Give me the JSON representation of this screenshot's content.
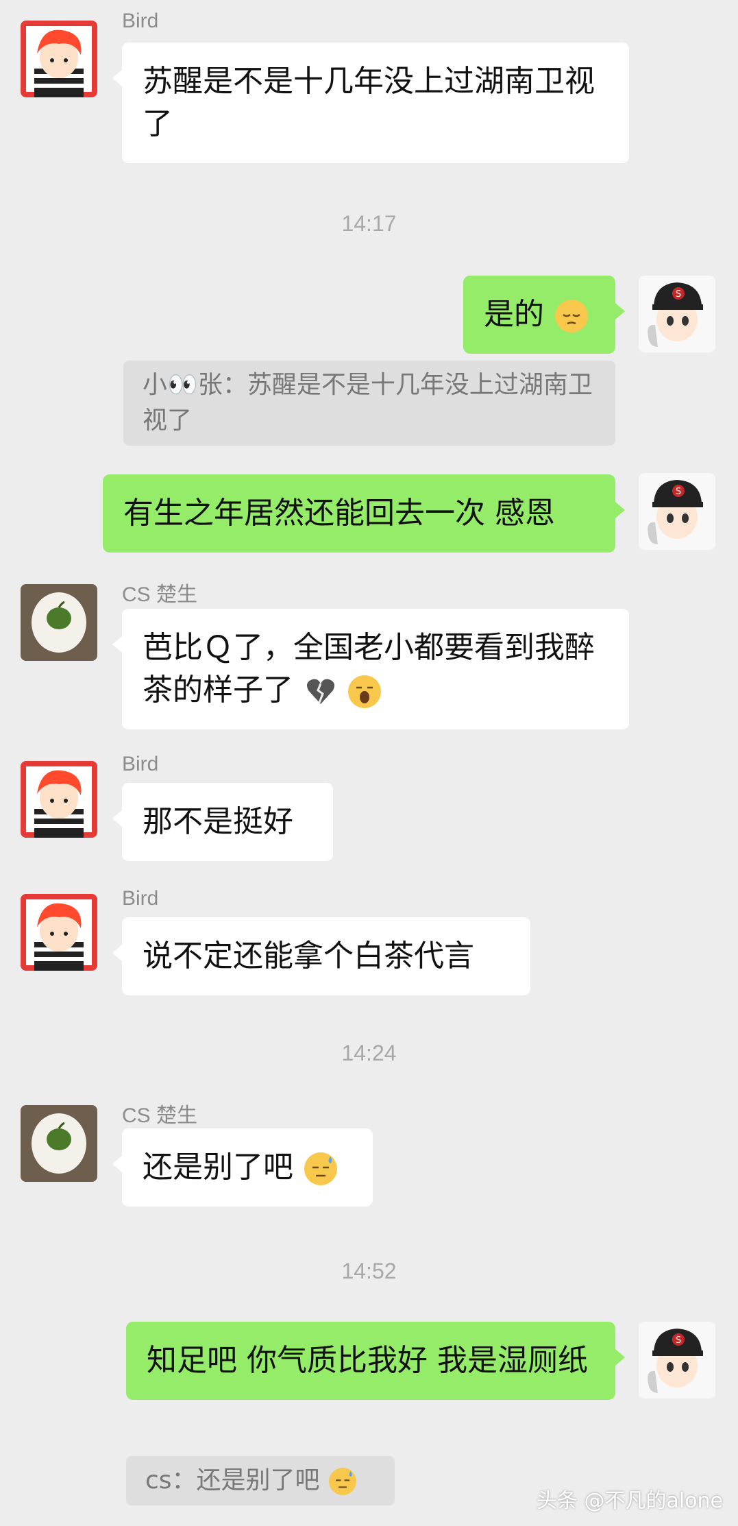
{
  "messages": [
    {
      "sender": "Bird",
      "text": "苏醒是不是十几年没上过湖南卫视了"
    },
    {
      "time": "14:17"
    },
    {
      "text": "是的",
      "emoji": "pensive-emoji"
    },
    {
      "quote": "小👀张：苏醒是不是十几年没上过湖南卫视了"
    },
    {
      "text": "有生之年居然还能回去一次 感恩"
    },
    {
      "sender": "CS 楚生",
      "text": "芭比Ｑ了，全国老小都要看到我醉茶的样子了",
      "emoji": [
        "broken-heart-emoji",
        "yawn-emoji"
      ]
    },
    {
      "sender": "Bird",
      "text": "那不是挺好"
    },
    {
      "sender": "Bird",
      "text": "说不定还能拿个白茶代言"
    },
    {
      "time": "14:24"
    },
    {
      "sender": "CS 楚生",
      "text": "还是别了吧",
      "emoji": "sweat-emoji"
    },
    {
      "time": "14:52"
    },
    {
      "text": "知足吧 你气质比我好 我是湿厕纸"
    },
    {
      "quote": "cs：还是别了吧",
      "emoji": "sweat-emoji"
    }
  ],
  "watermark": "头条 @不凡的alone",
  "colors": {
    "background": "#ededed",
    "self_bubble": "#95ec69",
    "other_bubble": "#ffffff",
    "quote_bg": "#dedede"
  }
}
